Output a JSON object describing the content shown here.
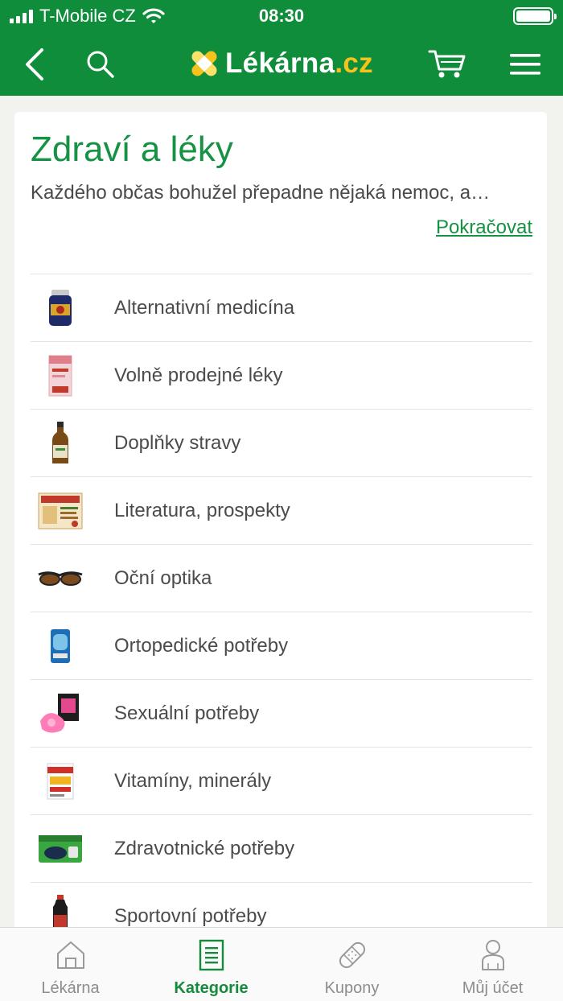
{
  "status_bar": {
    "carrier": "T-Mobile CZ",
    "time": "08:30"
  },
  "header": {
    "logo_main": "Lékárna",
    "logo_tld": ".cz"
  },
  "page": {
    "title": "Zdraví a léky",
    "description": "Každého občas bohužel přepadne nějaká nemoc, a…",
    "more_link": "Pokračovat"
  },
  "categories": [
    {
      "label": "Alternativní medicína",
      "icon": "supplement-jar-icon"
    },
    {
      "label": "Volně prodejné léky",
      "icon": "medicine-box-icon"
    },
    {
      "label": "Doplňky stravy",
      "icon": "bottle-icon"
    },
    {
      "label": "Literatura, prospekty",
      "icon": "book-icon"
    },
    {
      "label": "Oční optika",
      "icon": "glasses-icon"
    },
    {
      "label": "Ortopedické potřeby",
      "icon": "orthopedic-pack-icon"
    },
    {
      "label": "Sexuální potřeby",
      "icon": "pink-toy-icon"
    },
    {
      "label": "Vitamíny, minerály",
      "icon": "vitamin-box-icon"
    },
    {
      "label": "Zdravotnické potřeby",
      "icon": "blood-pressure-monitor-icon"
    },
    {
      "label": "Sportovní potřeby",
      "icon": "sport-bottle-icon"
    }
  ],
  "tabs": [
    {
      "label": "Lékárna",
      "icon": "home-icon",
      "active": false
    },
    {
      "label": "Kategorie",
      "icon": "document-list-icon",
      "active": true
    },
    {
      "label": "Kupony",
      "icon": "bandage-icon",
      "active": false
    },
    {
      "label": "Můj účet",
      "icon": "user-icon",
      "active": false
    }
  ],
  "colors": {
    "brand_green": "#0f8d3a",
    "accent_yellow": "#f6c21c",
    "link_green": "#159244"
  }
}
